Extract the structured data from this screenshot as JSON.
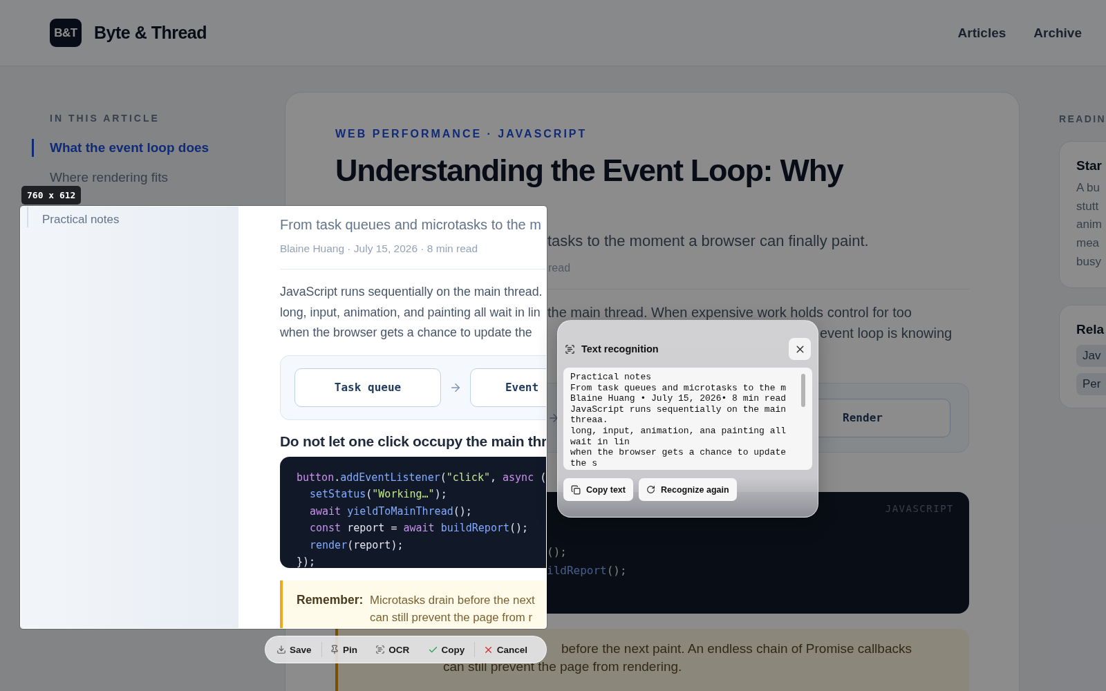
{
  "header": {
    "logo": "B&T",
    "title": "Byte & Thread",
    "nav": [
      {
        "label": "Articles"
      },
      {
        "label": "Archive"
      }
    ]
  },
  "toc": {
    "heading": "IN THIS ARTICLE",
    "items": [
      {
        "label": "What the event loop does",
        "selected": true
      },
      {
        "label": "Where rendering fits",
        "selected": false
      }
    ]
  },
  "article": {
    "category": "WEB PERFORMANCE · JAVASCRIPT",
    "title": "Understanding the Event Loop: Why",
    "subtitle": "tasks to the moment a browser can finally paint.",
    "meta": "read",
    "paragraph": [
      {
        "text": "the main thread. When expensive work holds control for too",
        "shifted": false
      },
      {
        "text": "event loop is knowing",
        "shifted": true
      }
    ],
    "diagram": {
      "steps": [
        {
          "label": "Render"
        }
      ]
    },
    "code": {
      "language": "JAVASCRIPT",
      "lines": [
        {
          "tokens": [
            {
              "text": "();",
              "kind": "plain"
            }
          ]
        },
        {
          "tokens": [
            {
              "text": "ildReport",
              "kind": "function"
            },
            {
              "text": "();",
              "kind": "plain"
            }
          ]
        }
      ]
    },
    "callout": {
      "lines": [
        {
          "text": "before the next paint. An endless chain of Promise callbacks",
          "shifted": true
        },
        {
          "text": "can still prevent the page from rendering.",
          "shifted": false
        }
      ]
    }
  },
  "sidebar": {
    "heading": "READIN",
    "cards": [
      {
        "title": "Star",
        "lines": [
          "A bu",
          "stutt",
          "anim",
          "mea",
          "busy"
        ]
      },
      {
        "title": "Rela",
        "tags": [
          "Jav",
          "Per"
        ]
      }
    ]
  },
  "capture": {
    "size": "760 x 612",
    "toc_item": "Practical notes",
    "subtitle": "From task queues and microtasks to the m",
    "meta": "Blaine Huang · July 15, 2026 · 8 min read",
    "paragraph": [
      "JavaScript runs sequentially on the main thread.",
      "long, input, animation, and painting all wait in lin",
      "when the browser gets a chance to update the"
    ],
    "diagram": {
      "steps": [
        {
          "label": "Task queue"
        },
        {
          "label": "Event"
        }
      ]
    },
    "heading": "Do not let one click occupy the main thr",
    "code": {
      "lines": [
        {
          "indented": false,
          "tokens": [
            {
              "text": "button",
              "kind": "keyword"
            },
            {
              "text": ".",
              "kind": "plain"
            },
            {
              "text": "addEventListener",
              "kind": "function"
            },
            {
              "text": "(",
              "kind": "plain"
            },
            {
              "text": "\"click\"",
              "kind": "string"
            },
            {
              "text": ", ",
              "kind": "plain"
            },
            {
              "text": "async",
              "kind": "keyword"
            },
            {
              "text": " (",
              "kind": "plain"
            }
          ]
        },
        {
          "indented": true,
          "tokens": [
            {
              "text": "setStatus",
              "kind": "function"
            },
            {
              "text": "(",
              "kind": "plain"
            },
            {
              "text": "\"Working…\"",
              "kind": "string"
            },
            {
              "text": ");",
              "kind": "plain"
            }
          ]
        },
        {
          "indented": true,
          "tokens": [
            {
              "text": "await ",
              "kind": "keyword"
            },
            {
              "text": "yieldToMainThread",
              "kind": "function"
            },
            {
              "text": "();",
              "kind": "plain"
            }
          ]
        },
        {
          "indented": true,
          "tokens": [
            {
              "text": "const",
              "kind": "keyword"
            },
            {
              "text": " report = ",
              "kind": "plain"
            },
            {
              "text": "await ",
              "kind": "keyword"
            },
            {
              "text": "buildReport",
              "kind": "function"
            },
            {
              "text": "();",
              "kind": "plain"
            }
          ]
        },
        {
          "indented": true,
          "tokens": [
            {
              "text": "render",
              "kind": "function"
            },
            {
              "text": "(report);",
              "kind": "plain"
            }
          ]
        },
        {
          "indented": false,
          "tokens": [
            {
              "text": "});",
              "kind": "plain"
            }
          ]
        }
      ]
    },
    "callout": {
      "label": "Remember:",
      "lines": [
        "Microtasks drain before the next",
        "can still prevent the page from r"
      ]
    }
  },
  "ocr": {
    "title": "Text recognition",
    "text": "Practical notes\nFrom task queues and microtasks to the m\nBlaine Huang • July 15, 2026• 8 min read\nJavaScript runs sequentially on the main threaa.\nlong, input, animation, ana painting all wait in lin\nwhen the browser gets a chance to update the s",
    "buttons": [
      {
        "label": "Copy text",
        "kind": "copy"
      },
      {
        "label": "Recognize again",
        "kind": "retry"
      }
    ]
  },
  "toolbar": [
    {
      "label": "Save",
      "kind": "save",
      "group_end": true
    },
    {
      "label": "Pin",
      "kind": "pin",
      "group_end": false
    },
    {
      "label": "OCR",
      "kind": "ocr",
      "group_end": false
    },
    {
      "label": "Copy",
      "kind": "copy",
      "group_end": true
    },
    {
      "label": "Cancel",
      "kind": "cancel",
      "group_end": false
    }
  ]
}
